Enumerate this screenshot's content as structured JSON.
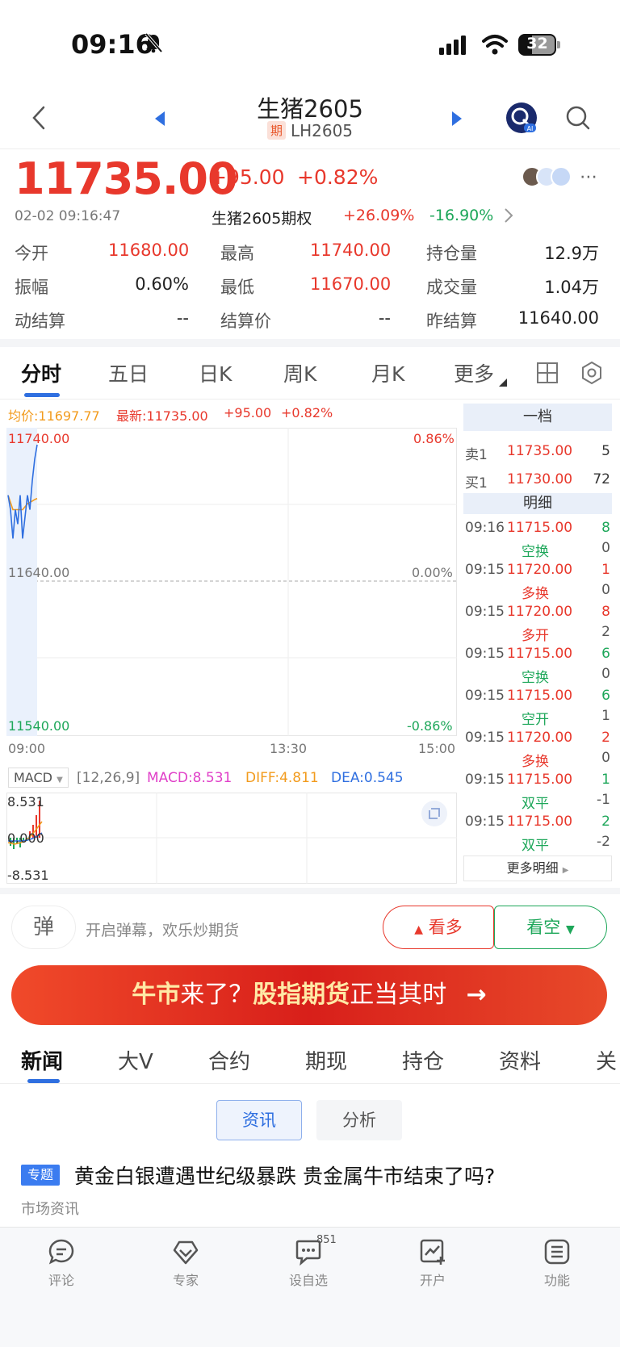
{
  "status": {
    "time": "09:16",
    "battery": "32"
  },
  "header": {
    "title": "生猪2605",
    "badge": "期",
    "code": "LH2605"
  },
  "quote": {
    "price": "11735.00",
    "change": "+95.00",
    "change_pct": "+0.82%",
    "datetime": "02-02 09:16:47",
    "option_name": "生猪2605期权",
    "option_up": "+26.09%",
    "option_down": "-16.90%"
  },
  "stats": [
    {
      "label": "今开",
      "value": "11680.00",
      "color": "red"
    },
    {
      "label": "最高",
      "value": "11740.00",
      "color": "red"
    },
    {
      "label": "持仓量",
      "value": "12.9万",
      "color": "black"
    },
    {
      "label": "振幅",
      "value": "0.60%",
      "color": "black"
    },
    {
      "label": "最低",
      "value": "11670.00",
      "color": "red"
    },
    {
      "label": "成交量",
      "value": "1.04万",
      "color": "black"
    },
    {
      "label": "动结算",
      "value": "--",
      "color": "black"
    },
    {
      "label": "结算价",
      "value": "--",
      "color": "black"
    },
    {
      "label": "昨结算",
      "value": "11640.00",
      "color": "black"
    }
  ],
  "ktabs": [
    "分时",
    "五日",
    "日K",
    "周K",
    "月K",
    "更多"
  ],
  "intraday": {
    "avg_label": "均价:11697.77",
    "latest_label": "最新:11735.00",
    "chg": "+95.00",
    "chg_pct": "+0.82%",
    "top_price": "11740.00",
    "top_pct": "0.86%",
    "mid_price": "11640.00",
    "mid_pct": "0.00%",
    "bottom_price": "11540.00",
    "bottom_pct": "-0.86%",
    "x_start": "09:00",
    "x_mid": "13:30",
    "x_end": "15:00"
  },
  "chart_data": {
    "type": "line",
    "series": [],
    "price_series": [
      11700,
      11690,
      11670,
      11690,
      11680,
      11700,
      11670,
      11685,
      11700,
      11690,
      11710,
      11725,
      11735
    ],
    "avg_series": [
      11700,
      11695,
      11690,
      11690,
      11690,
      11690,
      11690,
      11692,
      11694,
      11695,
      11696,
      11697,
      11697.77
    ],
    "ylim": [
      11540,
      11740
    ]
  },
  "macd": {
    "name": "MACD",
    "params": "[12,26,9]",
    "macd": "MACD:8.531",
    "diff": "DIFF:4.811",
    "dea": "DEA:0.545",
    "top": "8.531",
    "mid": "0.000",
    "bottom": "-8.531"
  },
  "orderbook": {
    "level_title": "一档",
    "sell_label": "卖1",
    "sell_price": "11735.00",
    "sell_vol": "5",
    "buy_label": "买1",
    "buy_price": "11730.00",
    "buy_vol": "72",
    "detail_title": "明细",
    "more": "更多明细",
    "trades": [
      {
        "time": "09:16",
        "price": "11715.00",
        "vol": "8",
        "vol_color": "green",
        "type": "空换",
        "type_color": "green",
        "oi": "0"
      },
      {
        "time": "09:15",
        "price": "11720.00",
        "vol": "1",
        "vol_color": "red",
        "type": "多换",
        "type_color": "red",
        "oi": "0"
      },
      {
        "time": "09:15",
        "price": "11720.00",
        "vol": "8",
        "vol_color": "red",
        "type": "多开",
        "type_color": "red",
        "oi": "2"
      },
      {
        "time": "09:15",
        "price": "11715.00",
        "vol": "6",
        "vol_color": "green",
        "type": "空换",
        "type_color": "green",
        "oi": "0"
      },
      {
        "time": "09:15",
        "price": "11715.00",
        "vol": "6",
        "vol_color": "green",
        "type": "空开",
        "type_color": "green",
        "oi": "1"
      },
      {
        "time": "09:15",
        "price": "11720.00",
        "vol": "2",
        "vol_color": "red",
        "type": "多换",
        "type_color": "red",
        "oi": "0"
      },
      {
        "time": "09:15",
        "price": "11715.00",
        "vol": "1",
        "vol_color": "green",
        "type": "双平",
        "type_color": "green",
        "oi": "-1"
      },
      {
        "time": "09:15",
        "price": "11715.00",
        "vol": "2",
        "vol_color": "green",
        "type": "双平",
        "type_color": "green",
        "oi": "-2"
      }
    ]
  },
  "danmu": {
    "icon": "弹",
    "text": "开启弹幕，欢乐炒期货"
  },
  "actions": {
    "long": "看多",
    "short": "看空"
  },
  "banner": {
    "part1": "牛市",
    "part2": "来了？",
    "part3": "股指期货",
    "part4": "正当其时"
  },
  "news_tabs": [
    "新闻",
    "大V",
    "合约",
    "期现",
    "持仓",
    "资料",
    "关"
  ],
  "subtabs": {
    "info": "资讯",
    "analysis": "分析"
  },
  "article": {
    "tag": "专题",
    "title": "黄金白银遭遇世纪级暴跌 贵金属牛市结束了吗?",
    "source": "市场资讯"
  },
  "tabbar": [
    {
      "label": "评论"
    },
    {
      "label": "专家"
    },
    {
      "label": "设自选",
      "badge": "851"
    },
    {
      "label": "开户"
    },
    {
      "label": "功能"
    }
  ],
  "colors": {
    "red": "#e8382c",
    "green": "#1ea75a",
    "blue": "#2f6fe0",
    "orange": "#f29b1d",
    "magenta": "#e040c8"
  }
}
